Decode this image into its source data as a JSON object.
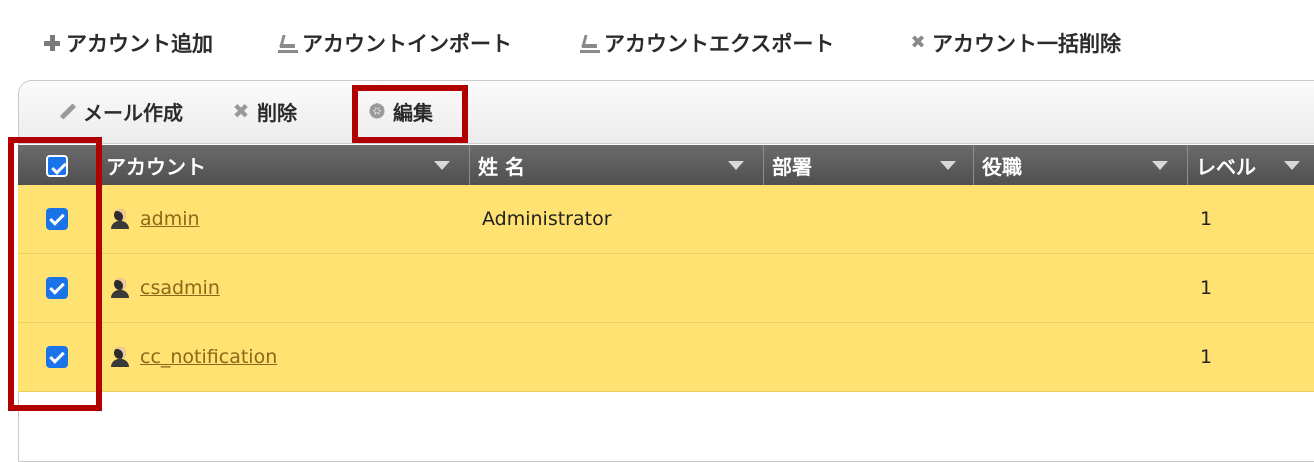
{
  "toolbar": {
    "add_account": "アカウント追加",
    "import_account": "アカウントインポート",
    "export_account": "アカウントエクスポート",
    "bulk_delete": "アカウント一括削除"
  },
  "panel_toolbar": {
    "compose_mail": "メール作成",
    "delete": "削除",
    "edit": "編集"
  },
  "table": {
    "headers": {
      "account": "アカウント",
      "name": "姓 名",
      "department": "部署",
      "position": "役職",
      "level": "レベル"
    },
    "rows": [
      {
        "account": "admin",
        "name": "Administrator",
        "department": "",
        "position": "",
        "level": "1",
        "checked": true
      },
      {
        "account": "csadmin",
        "name": "",
        "department": "",
        "position": "",
        "level": "1",
        "checked": true
      },
      {
        "account": "cc_notification",
        "name": "",
        "department": "",
        "position": "",
        "level": "1",
        "checked": true
      }
    ]
  },
  "colors": {
    "row_selected": "#ffe272",
    "header_bg": "#5a5a5a",
    "highlight": "#b00000",
    "checkbox": "#1a73e8"
  }
}
